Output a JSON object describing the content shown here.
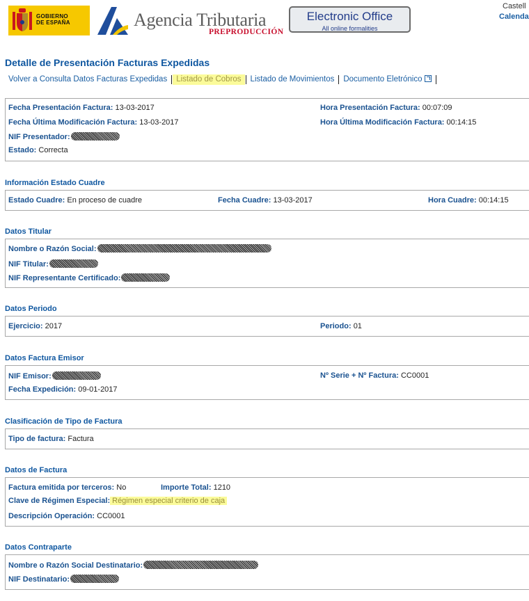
{
  "header": {
    "gov_logo_text": [
      "GOBIERNO",
      "DE ESPAÑA"
    ],
    "agency_name": "Agencia Tributaria",
    "environment": "PREPRODUCCIÓN",
    "eoffice_title": "Electronic Office",
    "eoffice_subtitle": "All online formalities",
    "language": "Castell",
    "calendar": "Calenda"
  },
  "page_title": "Detalle de Presentación Facturas Expedidas",
  "nav": [
    {
      "label": "Volver a Consulta Datos Facturas Expedidas",
      "active": false
    },
    {
      "label": "Listado de Cobros",
      "active": true
    },
    {
      "label": "Listado de Movimientos",
      "active": false
    },
    {
      "label": "Documento Eletrónico",
      "active": false,
      "icon": "external-link-icon"
    }
  ],
  "presentation": {
    "fecha_presentacion": {
      "label": "Fecha Presentación Factura:",
      "value": "13-03-2017"
    },
    "hora_presentacion": {
      "label": "Hora Presentación Factura:",
      "value": "00:07:09"
    },
    "fecha_modificacion": {
      "label": "Fecha Última Modificación Factura:",
      "value": "13-03-2017"
    },
    "hora_modificacion": {
      "label": "Hora Última Modificación Factura:",
      "value": "00:14:15"
    },
    "nif_presentador": {
      "label": "NIF Presentador:",
      "value": ""
    },
    "estado": {
      "label": "Estado:",
      "value": "Correcta"
    }
  },
  "estado_cuadre": {
    "title": "Información Estado Cuadre",
    "estado": {
      "label": "Estado Cuadre:",
      "value": "En proceso de cuadre"
    },
    "fecha": {
      "label": "Fecha Cuadre:",
      "value": "13-03-2017"
    },
    "hora": {
      "label": "Hora Cuadre:",
      "value": "00:14:15"
    }
  },
  "titular": {
    "title": "Datos Titular",
    "nombre": {
      "label": "Nombre o Razón Social:",
      "value": ""
    },
    "nif": {
      "label": "NIF Titular:",
      "value": ""
    },
    "nif_representante": {
      "label": "NIF Representante Certificado:",
      "value": ""
    }
  },
  "periodo": {
    "title": "Datos Periodo",
    "ejercicio": {
      "label": "Ejercicio:",
      "value": "2017"
    },
    "periodo": {
      "label": "Periodo:",
      "value": "01"
    }
  },
  "emisor": {
    "title": "Datos Factura Emisor",
    "nif": {
      "label": "NIF Emisor:",
      "value": ""
    },
    "serie": {
      "label": "Nº Serie + Nº Factura:",
      "value": "CC0001"
    },
    "fecha_expedicion": {
      "label": "Fecha Expedición:",
      "value": "09-01-2017"
    }
  },
  "clasificacion": {
    "title": "Clasificación de Tipo de Factura",
    "tipo": {
      "label": "Tipo de factura:",
      "value": "Factura"
    }
  },
  "factura": {
    "title": "Datos de Factura",
    "terceros": {
      "label": "Factura emitida por terceros:",
      "value": "No"
    },
    "importe": {
      "label": "Importe Total:",
      "value": "1210"
    },
    "regimen": {
      "label": "Clave de Régimen Especial:",
      "value": "Régimen especial criterio de caja"
    },
    "descripcion": {
      "label": "Descripción Operación:",
      "value": "CC0001"
    }
  },
  "contraparte": {
    "title": "Datos Contraparte",
    "nombre": {
      "label": "Nombre o Razón Social Destinatario:",
      "value": ""
    },
    "nif": {
      "label": "NIF Destinatario:",
      "value": ""
    }
  },
  "colors": {
    "brand_blue": "#0f57a0",
    "label_blue": "#1a5290",
    "highlight": "#fbfb9a",
    "gov_yellow": "#f6c800"
  }
}
